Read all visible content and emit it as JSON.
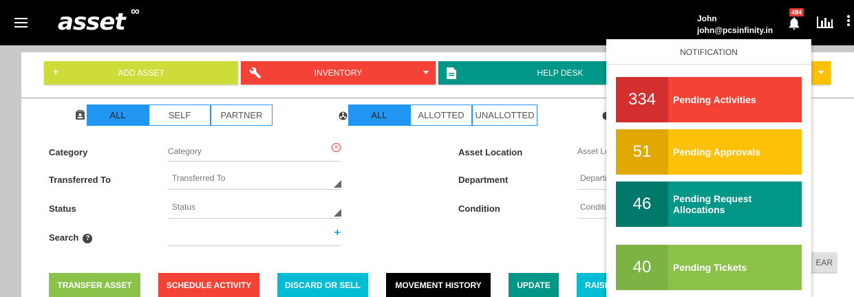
{
  "header": {
    "logo": "asset",
    "logo_mark": "∞",
    "user_name": "John",
    "user_email": "john@pcsinfinity.in",
    "notification_count": "484"
  },
  "toolbar": {
    "add_asset": "ADD ASSET",
    "inventory": "INVENTORY",
    "help_desk": "HELP DESK"
  },
  "filters": {
    "group1": [
      "ALL",
      "SELF",
      "PARTNER"
    ],
    "group2": [
      "ALL",
      "ALLOTTED",
      "UNALLOTTED"
    ]
  },
  "form": {
    "category_label": "Category",
    "category_placeholder": "Category",
    "transferred_label": "Transferred To",
    "transferred_placeholder": "Transferred To",
    "status_label": "Status",
    "status_placeholder": "Status",
    "search_label": "Search",
    "asset_location_label": "Asset Location",
    "asset_location_placeholder": "Asset Location",
    "department_label": "Department",
    "department_placeholder": "Department",
    "condition_label": "Condition",
    "condition_placeholder": "Condition"
  },
  "actions": {
    "transfer": "TRANSFER ASSET",
    "schedule": "SCHEDULE ACTIVITY",
    "discard": "DISCARD OR SELL",
    "movement": "MOVEMENT HISTORY",
    "update": "UPDATE",
    "raise": "RAISE",
    "clear": "EAR"
  },
  "notifications": {
    "title": "NOTIFICATION",
    "items": [
      {
        "count": "334",
        "label": "Pending Activities"
      },
      {
        "count": "51",
        "label": "Pending Approvals"
      },
      {
        "count": "46",
        "label": "Pending Request Allocations"
      },
      {
        "count": "40",
        "label": "Pending Tickets"
      }
    ]
  },
  "colors": {
    "lime": "#cddc39",
    "red": "#f44336",
    "teal": "#009688",
    "amber": "#ffc107",
    "blue": "#2196f3",
    "green": "#8bc34a",
    "cyan": "#00bcd4",
    "black": "#000000"
  }
}
